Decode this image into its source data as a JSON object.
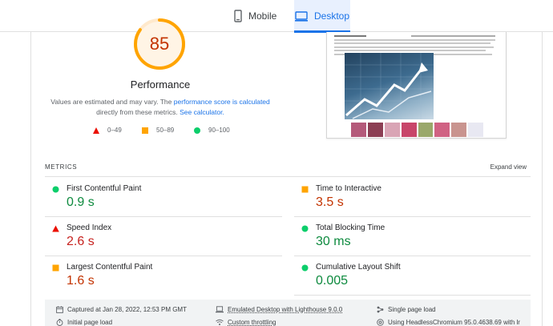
{
  "tabs": [
    {
      "label": "Mobile",
      "active": false
    },
    {
      "label": "Desktop",
      "active": true
    }
  ],
  "performance": {
    "score": "85",
    "score_fraction": 0.85,
    "title": "Performance",
    "desc_part1": "Values are estimated and may vary. The ",
    "desc_link1": "performance score is calculated",
    "desc_part2": " directly from these metrics. ",
    "desc_link2": "See calculator.",
    "legend": [
      {
        "label": "0–49",
        "shape": "triangle",
        "color": "#eb0f00"
      },
      {
        "label": "50–89",
        "shape": "square",
        "color": "#ffa400"
      },
      {
        "label": "90–100",
        "shape": "circle",
        "color": "#0cce6b"
      }
    ]
  },
  "metrics": {
    "header": "METRICS",
    "expand_label": "Expand view",
    "items": [
      {
        "name": "First Contentful Paint",
        "value": "0.9 s",
        "rating": "good"
      },
      {
        "name": "Time to Interactive",
        "value": "3.5 s",
        "rating": "average"
      },
      {
        "name": "Speed Index",
        "value": "2.6 s",
        "rating": "poor"
      },
      {
        "name": "Total Blocking Time",
        "value": "30 ms",
        "rating": "good"
      },
      {
        "name": "Largest Contentful Paint",
        "value": "1.6 s",
        "rating": "average"
      },
      {
        "name": "Cumulative Layout Shift",
        "value": "0.005",
        "rating": "good"
      }
    ]
  },
  "footer": {
    "captured": "Captured at Jan 28, 2022, 12:53 PM GMT",
    "emulated": "Emulated Desktop with Lighthouse 9.0.0",
    "single_page": "Single page load",
    "initial_load": "Initial page load",
    "throttling": "Custom throttling",
    "browser": "Using HeadlessChromium 95.0.4638.69 with lr"
  },
  "colors": {
    "accent": "#1a73e8",
    "good": "#0cce6b",
    "average": "#ffa400",
    "poor": "#eb0f00"
  }
}
